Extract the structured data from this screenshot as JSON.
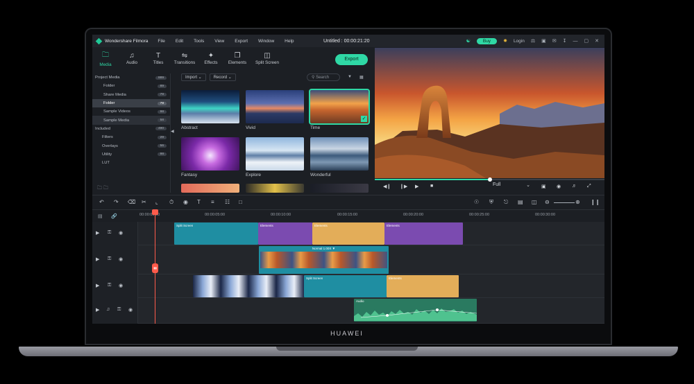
{
  "app": {
    "name": "Wondershare Filmora",
    "window_title": "Untitled : 00:00:21:20",
    "buy_label": "Buy",
    "login_label": "Login",
    "brand": "HUAWEI"
  },
  "menu": [
    "File",
    "Edit",
    "Tools",
    "View",
    "Export",
    "Window",
    "Help"
  ],
  "media_tabs": [
    {
      "label": "Media",
      "icon": "folder-icon"
    },
    {
      "label": "Audio",
      "icon": "music-note-icon"
    },
    {
      "label": "Titles",
      "icon": "text-icon"
    },
    {
      "label": "Transitions",
      "icon": "transition-icon"
    },
    {
      "label": "Effects",
      "icon": "sparkle-icon"
    },
    {
      "label": "Elements",
      "icon": "elements-icon"
    },
    {
      "label": "Split Screen",
      "icon": "split-screen-icon"
    }
  ],
  "export_label": "Export",
  "sidebar": [
    {
      "label": "Project Media",
      "count": "889"
    },
    {
      "label": "Folder",
      "count": "89"
    },
    {
      "label": "Share Media",
      "count": "78"
    },
    {
      "label": "Folder",
      "count": "78"
    },
    {
      "label": "Sample Videos",
      "count": "98"
    },
    {
      "label": "Sample Media",
      "count": "58"
    },
    {
      "label": "Included",
      "count": "490"
    },
    {
      "label": "Filters",
      "count": "29"
    },
    {
      "label": "Overlays",
      "count": "56"
    },
    {
      "label": "Utility",
      "count": "98"
    },
    {
      "label": "LUT",
      "count": ""
    }
  ],
  "media_toolbar": {
    "import": "Import",
    "record": "Record",
    "search_placeholder": "Search"
  },
  "thumbnails": [
    {
      "label": "Abstract"
    },
    {
      "label": "Vivid"
    },
    {
      "label": "Time"
    },
    {
      "label": "Fantasy"
    },
    {
      "label": "Explore"
    },
    {
      "label": "Wonderful"
    }
  ],
  "preview": {
    "quality": "Full",
    "progress": 0.5
  },
  "ruler": [
    "00:00:00:00",
    "00:00:05:00",
    "00:00:10:00",
    "00:00:15:00",
    "00:00:20:00",
    "00:00:25:00",
    "00:00:30:00"
  ],
  "clips": {
    "split_screen": "Split Screen",
    "elements": "Elements",
    "speed": "Normal 1.00X ▼",
    "audio": "Audio"
  }
}
